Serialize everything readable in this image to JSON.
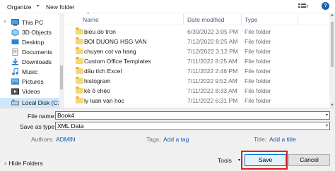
{
  "toolbar": {
    "organize": "Organize",
    "organize_arrow": "▾",
    "new_folder": "New folder",
    "help": "?"
  },
  "nav": {
    "items": [
      {
        "label": "This PC",
        "icon": "pc-icon"
      },
      {
        "label": "3D Objects",
        "icon": "cube-icon"
      },
      {
        "label": "Desktop",
        "icon": "desktop-icon"
      },
      {
        "label": "Documents",
        "icon": "documents-icon"
      },
      {
        "label": "Downloads",
        "icon": "download-icon"
      },
      {
        "label": "Music",
        "icon": "music-icon"
      },
      {
        "label": "Pictures",
        "icon": "pictures-icon"
      },
      {
        "label": "Videos",
        "icon": "videos-icon"
      },
      {
        "label": "Local Disk (C:)",
        "icon": "drive-icon"
      }
    ]
  },
  "list": {
    "headers": {
      "name": "Name",
      "date": "Date modified",
      "type": "Type"
    },
    "rows": [
      {
        "name": "bieu do tron",
        "date": "6/30/2022 3:05 PM",
        "type": "File folder"
      },
      {
        "name": "BOI DUONG HSG VAN",
        "date": "7/12/2022 8:25 AM",
        "type": "File folder"
      },
      {
        "name": "chuyen cot va hang",
        "date": "7/12/2022 3:12 PM",
        "type": "File folder"
      },
      {
        "name": "Custom Office Templates",
        "date": "7/11/2022 8:25 AM",
        "type": "File folder"
      },
      {
        "name": "dấu tích Excel",
        "date": "7/11/2022 2:46 PM",
        "type": "File folder"
      },
      {
        "name": "histogram",
        "date": "7/11/2022 9:52 AM",
        "type": "File folder"
      },
      {
        "name": "kẻ ô chéo",
        "date": "7/11/2022 8:33 AM",
        "type": "File folder"
      },
      {
        "name": "ly luan van hoc",
        "date": "7/11/2022 6:31 PM",
        "type": "File folder"
      }
    ]
  },
  "form": {
    "file_name_label": "File name:",
    "file_name_value": "Book4",
    "save_as_type_label": "Save as type:",
    "save_as_type_value": "XML Data",
    "authors_label": "Authors:",
    "authors_value": "ADMIN",
    "tags_label": "Tags:",
    "tags_value": "Add a tag",
    "title_label": "Title:",
    "title_value": "Add a title",
    "hide_folders": "Hide Folders",
    "tools": "Tools",
    "save": "Save",
    "cancel": "Cancel"
  },
  "colors": {
    "highlight": "#e01e1e",
    "link": "#0f5bb5",
    "selected_nav": "#cce8ff"
  }
}
